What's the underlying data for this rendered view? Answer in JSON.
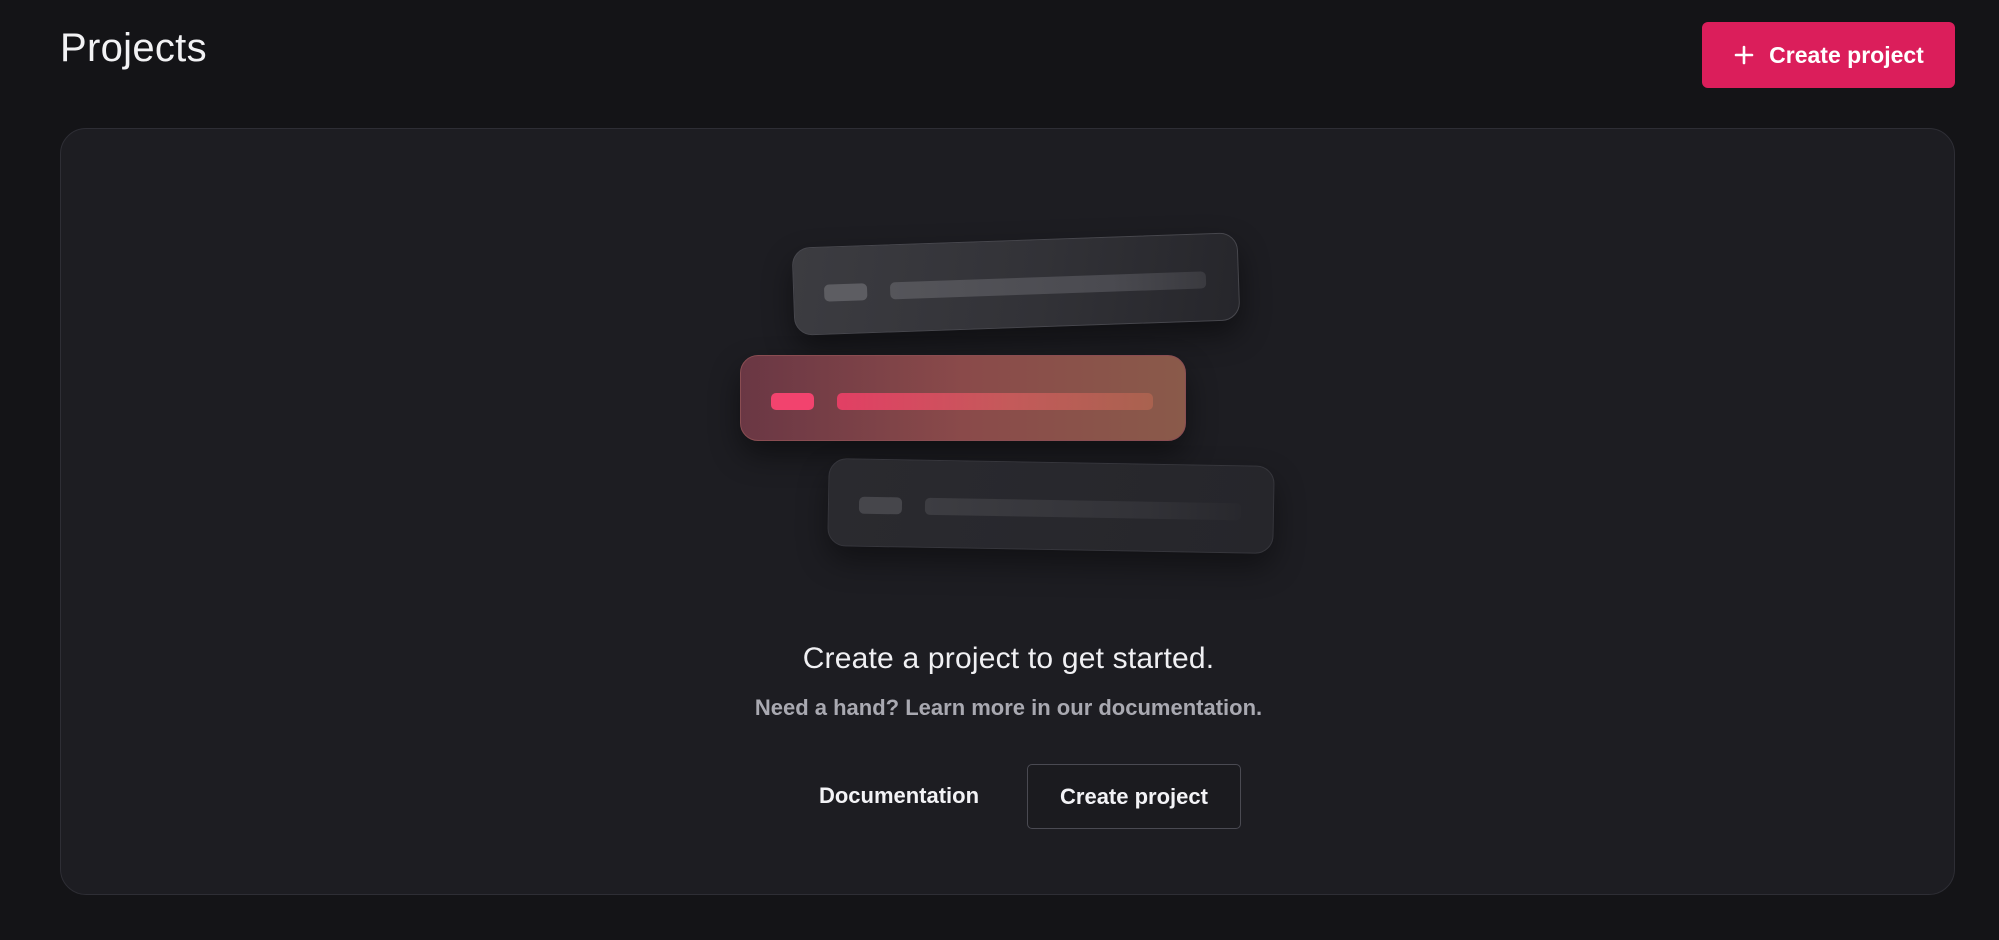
{
  "header": {
    "title": "Projects",
    "create_button_label": "Create project",
    "create_button_icon": "plus-icon"
  },
  "empty_state": {
    "heading": "Create a project to get started.",
    "subtext": "Need a hand? Learn more in our documentation.",
    "documentation_label": "Documentation",
    "create_button_label": "Create project"
  },
  "colors": {
    "background": "#141417",
    "panel": "#1d1d22",
    "accent": "#db1e5b",
    "highlight_chip": "#f2436e"
  }
}
